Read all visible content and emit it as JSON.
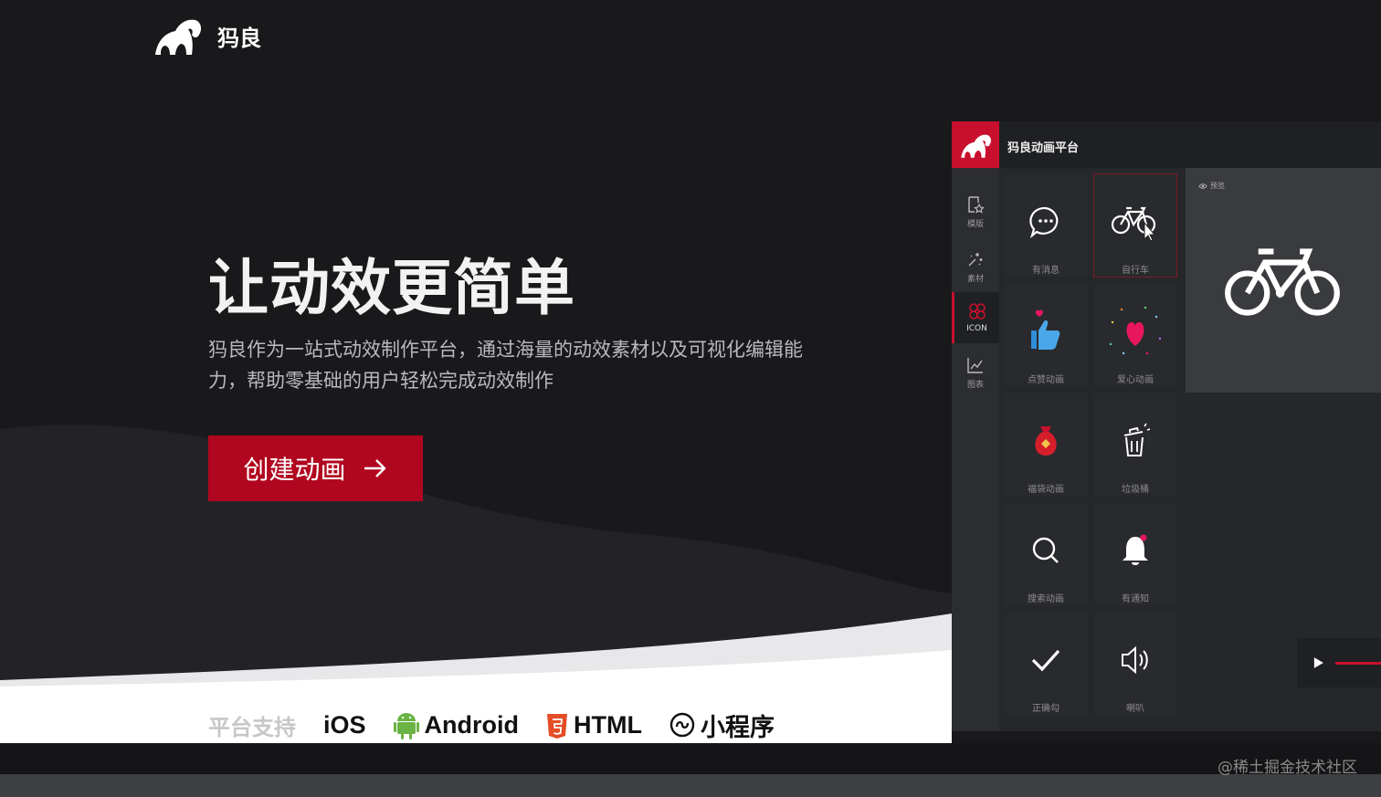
{
  "brand": {
    "name": "犸良",
    "accent": "#c8102e",
    "cta_color": "#b1061f"
  },
  "hero": {
    "headline": "让动效更简单",
    "subline": "犸良作为一站式动效制作平台，通过海量的动效素材以及可视化编辑能力，帮助零基础的用户轻松完成动效制作",
    "cta_label": "创建动画",
    "cta_icon": "arrow-right-icon"
  },
  "platforms": {
    "label": "平台支持",
    "items": [
      {
        "name": "iOS",
        "icon": ""
      },
      {
        "name": "Android",
        "icon": "android-icon"
      },
      {
        "name": "HTML",
        "icon": "html5-icon"
      },
      {
        "name": "小程序",
        "icon": "miniprogram-icon"
      }
    ]
  },
  "app": {
    "title": "犸良动画平台",
    "sidebar": [
      {
        "label": "模版",
        "icon": "template-icon"
      },
      {
        "label": "素材",
        "icon": "sparkle-icon"
      },
      {
        "label": "ICON",
        "icon": "clover-icon",
        "active": true
      },
      {
        "label": "图表",
        "icon": "chart-icon"
      }
    ],
    "icons": [
      {
        "label": "有消息",
        "icon": "chat-bubble-icon"
      },
      {
        "label": "自行车",
        "icon": "bicycle-icon",
        "selected": true
      },
      {
        "label": "点赞动画",
        "icon": "thumbs-up-icon"
      },
      {
        "label": "爱心动画",
        "icon": "heart-icon"
      },
      {
        "label": "福袋动画",
        "icon": "lucky-bag-icon"
      },
      {
        "label": "垃圾桶",
        "icon": "trash-icon"
      },
      {
        "label": "搜索动画",
        "icon": "search-icon"
      },
      {
        "label": "有通知",
        "icon": "bell-icon"
      },
      {
        "label": "正确勾",
        "icon": "check-icon"
      },
      {
        "label": "喇叭",
        "icon": "speaker-icon"
      }
    ],
    "preview_label": "预览",
    "preview_icon": "bicycle-icon",
    "player_icon": "play-icon"
  },
  "watermark": "@稀土掘金技术社区"
}
